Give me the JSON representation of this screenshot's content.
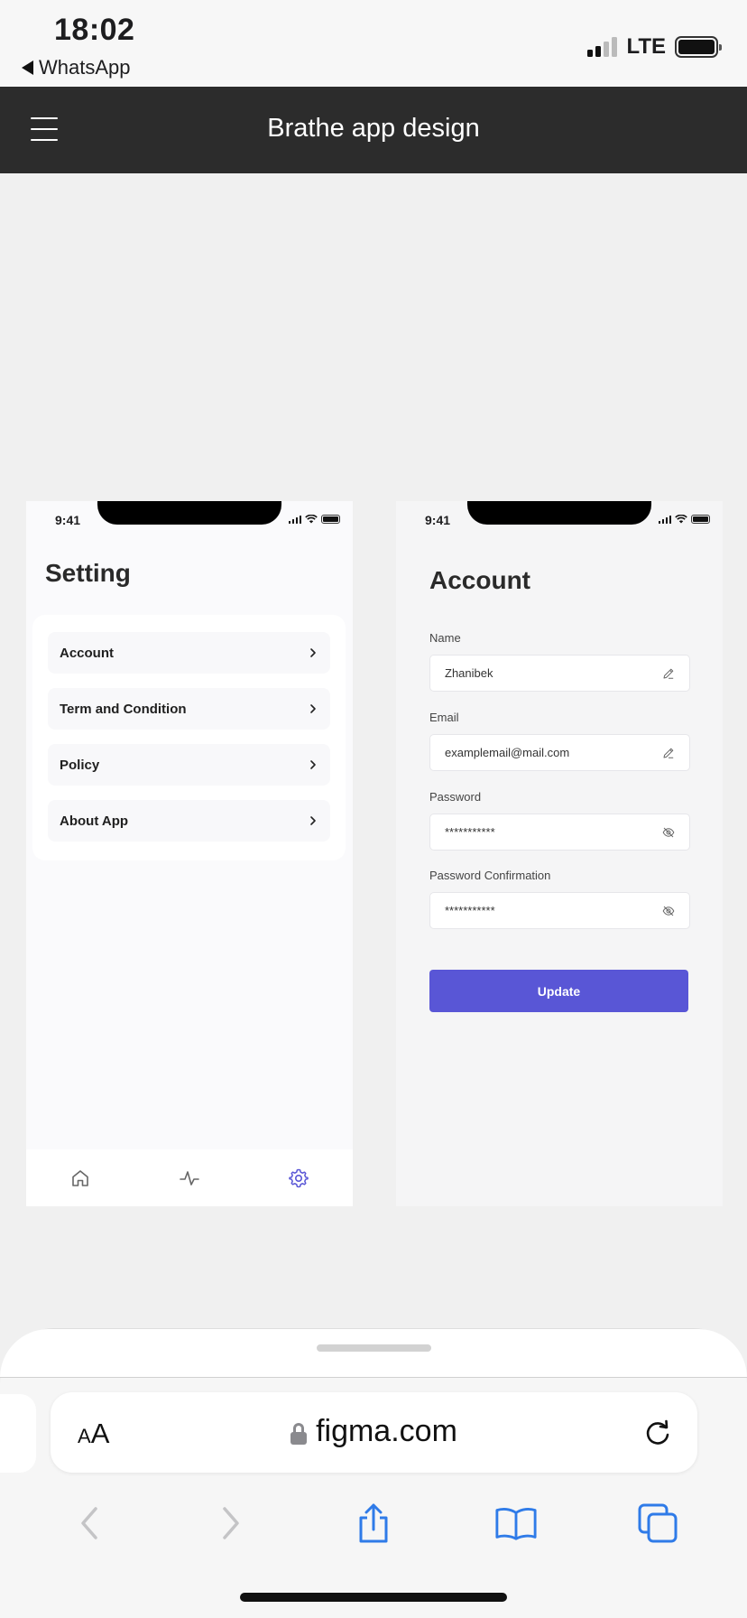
{
  "ios": {
    "time": "18:02",
    "back_app": "WhatsApp",
    "network": "LTE"
  },
  "figma": {
    "title": "Brathe app design"
  },
  "setting_screen": {
    "time": "9:41",
    "title": "Setting",
    "items": [
      {
        "label": "Account"
      },
      {
        "label": "Term and Condition"
      },
      {
        "label": "Policy"
      },
      {
        "label": "About App"
      }
    ],
    "tabs": [
      "home-icon",
      "activity-icon",
      "gear-icon"
    ],
    "active_color": "#5956d6"
  },
  "account_screen": {
    "time": "9:41",
    "title": "Account",
    "fields": [
      {
        "label": "Name",
        "value": "Zhanibek",
        "icon": "pencil-icon"
      },
      {
        "label": "Email",
        "value": "examplemail@mail.com",
        "icon": "pencil-icon"
      },
      {
        "label": "Password",
        "value": "***********",
        "icon": "eye-off-icon"
      },
      {
        "label": "Password Confirmation",
        "value": "***********",
        "icon": "eye-off-icon"
      }
    ],
    "button_label": "Update",
    "accent": "#5956d6"
  },
  "safari": {
    "text_size_label_small": "A",
    "text_size_label_large": "A",
    "url": "figma.com"
  }
}
